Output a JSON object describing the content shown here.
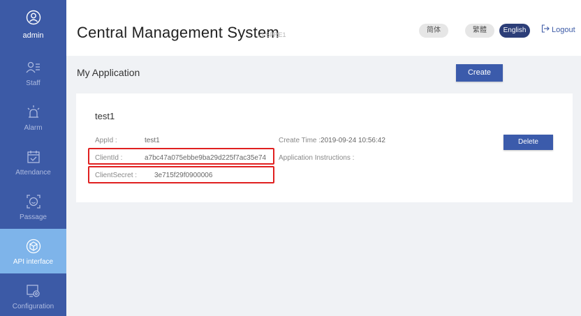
{
  "sidebar": {
    "user": "admin",
    "items": [
      {
        "label": "Staff",
        "icon": "staff-icon"
      },
      {
        "label": "Alarm",
        "icon": "alarm-icon"
      },
      {
        "label": "Attendance",
        "icon": "attendance-icon"
      },
      {
        "label": "Passage",
        "icon": "passage-icon"
      },
      {
        "label": "API interface",
        "icon": "api-cube-icon"
      },
      {
        "label": "Configuration",
        "icon": "configuration-icon"
      }
    ],
    "active": "API interface"
  },
  "header": {
    "title": "Central Management System",
    "version": "v1.5PRE1",
    "lang_simplified": "简体",
    "lang_traditional": "繁體",
    "lang_english": "English",
    "logout": "Logout"
  },
  "section": {
    "title": "My Application",
    "create_label": "Create"
  },
  "app": {
    "name": "test1",
    "appid_label": "AppId :",
    "appid_value": "test1",
    "clientid_label": "ClientId :",
    "clientid_value": "a7bc47a075ebbe9ba29d225f7ac35e74",
    "clientsecret_label": "ClientSecret :",
    "clientsecret_value": "3e715f29f0900006",
    "create_time_label": "Create Time :",
    "create_time_value": "2019-09-24 10:56:42",
    "instructions_label": "Application Instructions :",
    "delete_label": "Delete"
  },
  "colors": {
    "sidebar": "#3c5aa6",
    "active": "#7eb4ea",
    "button": "#3b5bab",
    "highlight": "#e02020"
  }
}
